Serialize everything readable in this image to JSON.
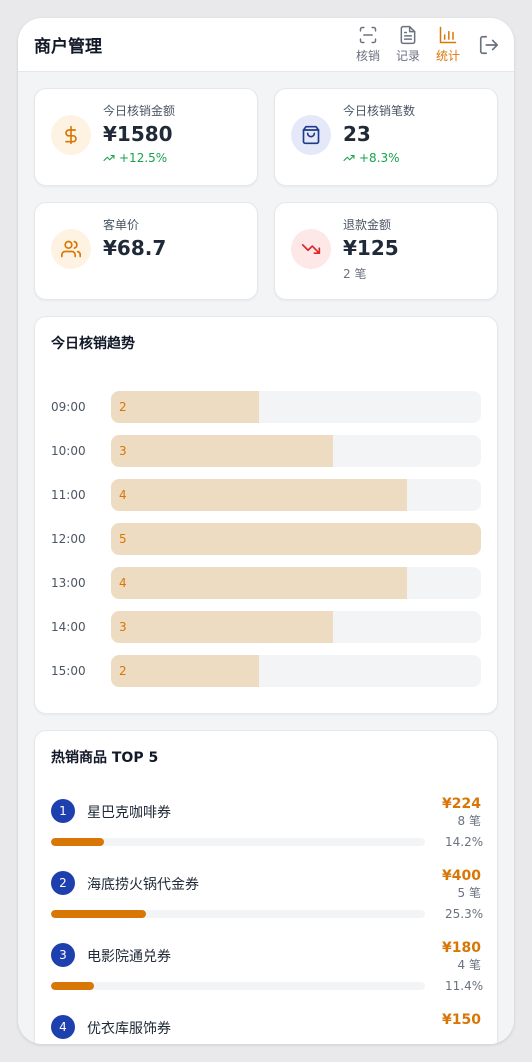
{
  "header": {
    "title": "商户管理",
    "nav": [
      {
        "label": "核销",
        "icon": "scan-icon",
        "active": false
      },
      {
        "label": "记录",
        "icon": "document-icon",
        "active": false
      },
      {
        "label": "统计",
        "icon": "bar-chart-icon",
        "active": true
      }
    ],
    "logout_icon": "logout-icon"
  },
  "stats": [
    {
      "label": "今日核销金额",
      "value": "¥1580",
      "sub": "+12.5%",
      "icon": "dollar-icon",
      "trend": "up"
    },
    {
      "label": "今日核销笔数",
      "value": "23",
      "sub": "+8.3%",
      "icon": "shopping-bag-icon",
      "trend": "up"
    },
    {
      "label": "客单价",
      "value": "¥68.7",
      "sub": "",
      "icon": "users-icon",
      "trend": "none"
    },
    {
      "label": "退款金额",
      "value": "¥125",
      "sub": "2 笔",
      "icon": "trending-down-icon",
      "trend": "none"
    }
  ],
  "trend": {
    "title": "今日核销趋势",
    "rows": [
      {
        "time": "09:00",
        "count": "2"
      },
      {
        "time": "10:00",
        "count": "3"
      },
      {
        "time": "11:00",
        "count": "4"
      },
      {
        "time": "12:00",
        "count": "5"
      },
      {
        "time": "13:00",
        "count": "4"
      },
      {
        "time": "14:00",
        "count": "3"
      },
      {
        "time": "15:00",
        "count": "2"
      }
    ],
    "max": 5
  },
  "top5": {
    "title": "热销商品 TOP 5",
    "items": [
      {
        "rank": "1",
        "name": "星巴克咖啡券",
        "amount": "¥224",
        "count": "8 笔",
        "percent": "14.2%",
        "share": 0.142
      },
      {
        "rank": "2",
        "name": "海底捞火锅代金券",
        "amount": "¥400",
        "count": "5 笔",
        "percent": "25.3%",
        "share": 0.253
      },
      {
        "rank": "3",
        "name": "电影院通兑券",
        "amount": "¥180",
        "count": "4 笔",
        "percent": "11.4%",
        "share": 0.114
      },
      {
        "rank": "4",
        "name": "优衣库服饰券",
        "amount": "¥150",
        "count": "",
        "percent": "",
        "share": 0
      }
    ]
  },
  "colors": {
    "accent": "#d97706",
    "rank_badge": "#1e40af",
    "positive": "#16a34a",
    "negative": "#dc2626"
  }
}
